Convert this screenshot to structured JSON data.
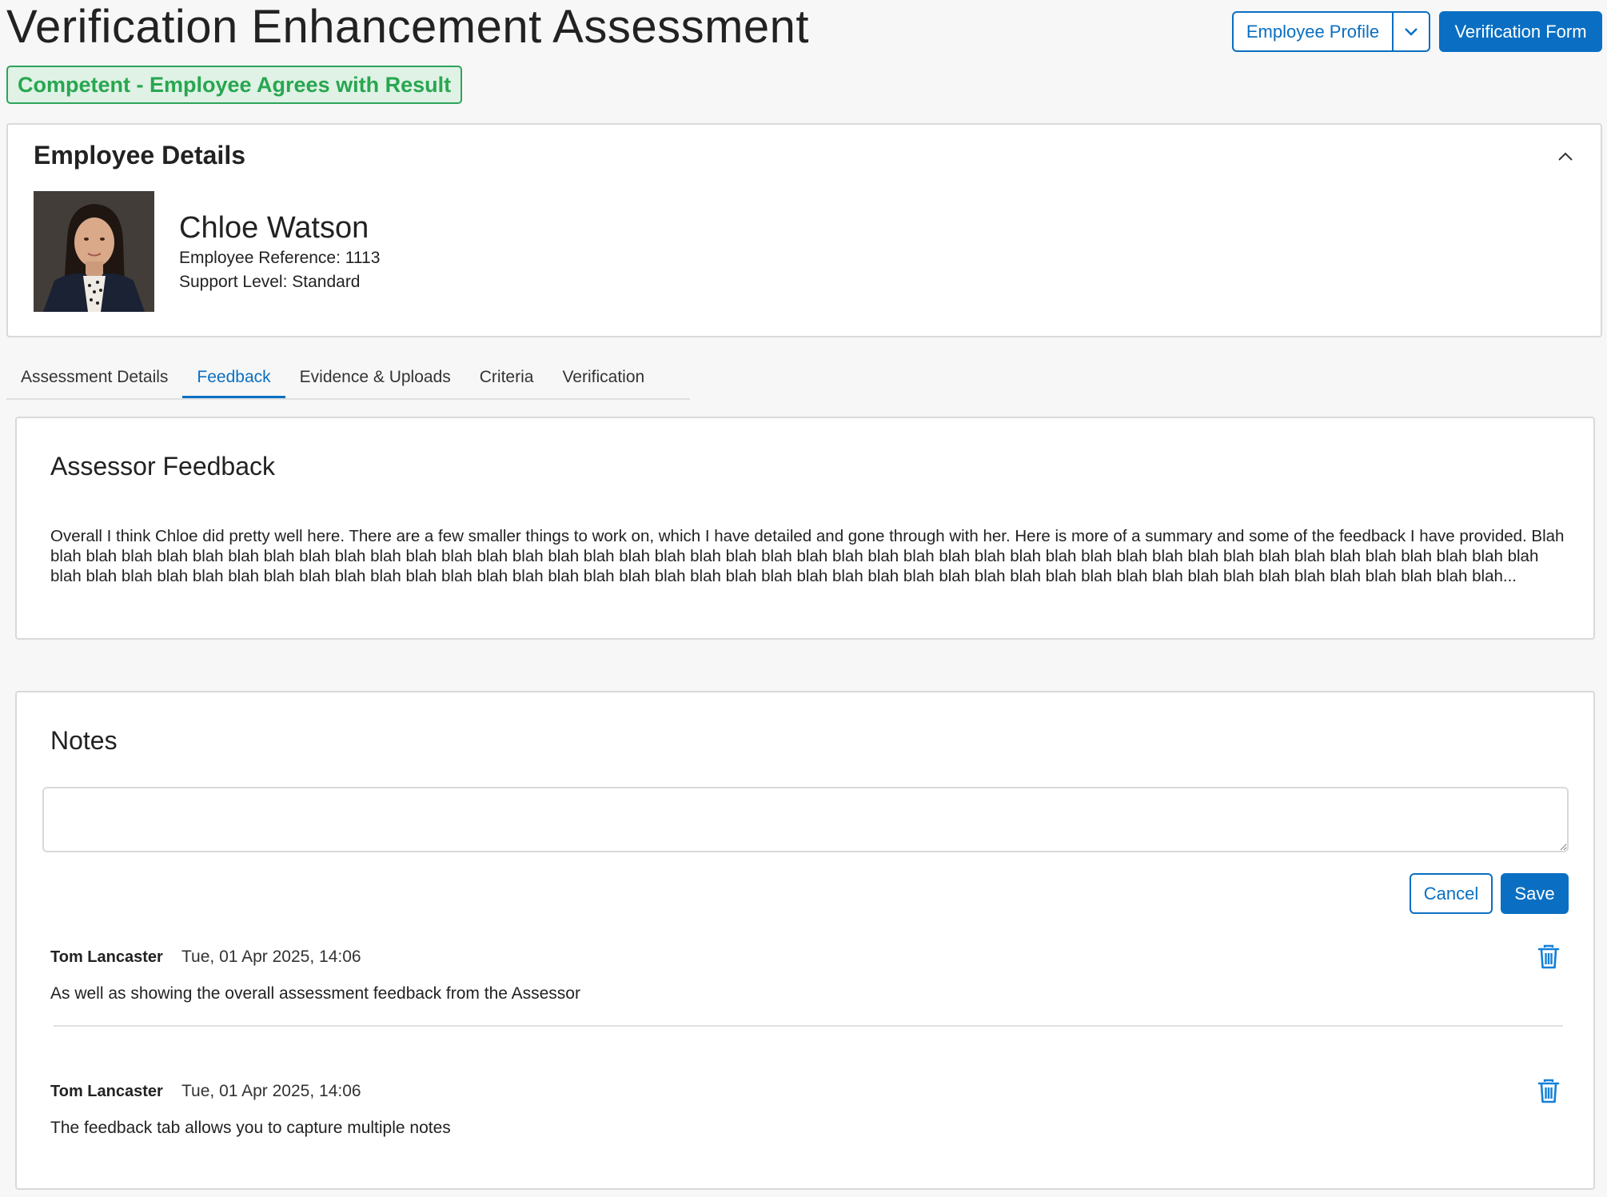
{
  "header": {
    "title": "Verification Enhancement Assessment",
    "status": "Competent - Employee Agrees with Result",
    "profile_button": "Employee Profile",
    "verification_button": "Verification Form"
  },
  "employee": {
    "section_title": "Employee Details",
    "name": "Chloe Watson",
    "reference": "Employee Reference: 1113",
    "support_level": "Support Level: Standard"
  },
  "tabs": [
    {
      "label": "Assessment Details",
      "active": false
    },
    {
      "label": "Feedback",
      "active": true
    },
    {
      "label": "Evidence & Uploads",
      "active": false
    },
    {
      "label": "Criteria",
      "active": false
    },
    {
      "label": "Verification",
      "active": false
    }
  ],
  "feedback": {
    "title": "Assessor Feedback",
    "text": "Overall I think Chloe did pretty well here. There are a few smaller things to work on, which I have detailed and gone through with her. Here is more of a summary and some of the feedback I have provided. Blah blah blah blah blah blah blah blah blah blah blah blah blah blah blah blah blah blah blah blah blah blah blah blah blah blah blah blah blah blah blah blah blah blah blah blah blah blah blah blah blah blah blah blah blah blah blah blah blah blah blah blah blah blah blah blah blah blah blah blah blah blah blah blah blah blah blah blah blah blah blah blah blah blah blah blah blah blah blah blah blah blah blah blah..."
  },
  "notes": {
    "title": "Notes",
    "input_value": "",
    "cancel_label": "Cancel",
    "save_label": "Save",
    "items": [
      {
        "author": "Tom Lancaster",
        "timestamp": "Tue, 01 Apr 2025, 14:06",
        "body": "As well as showing the overall assessment feedback from the Assessor"
      },
      {
        "author": "Tom Lancaster",
        "timestamp": "Tue, 01 Apr 2025, 14:06",
        "body": "The feedback tab allows you to capture multiple notes"
      }
    ]
  },
  "colors": {
    "accent": "#0a6fc2",
    "success": "#28a650",
    "success_bg": "#dff2e5"
  },
  "icons": {
    "profile_dropdown": "chevron-down-icon",
    "collapse": "chevron-up-icon",
    "delete_note": "trash-icon"
  }
}
